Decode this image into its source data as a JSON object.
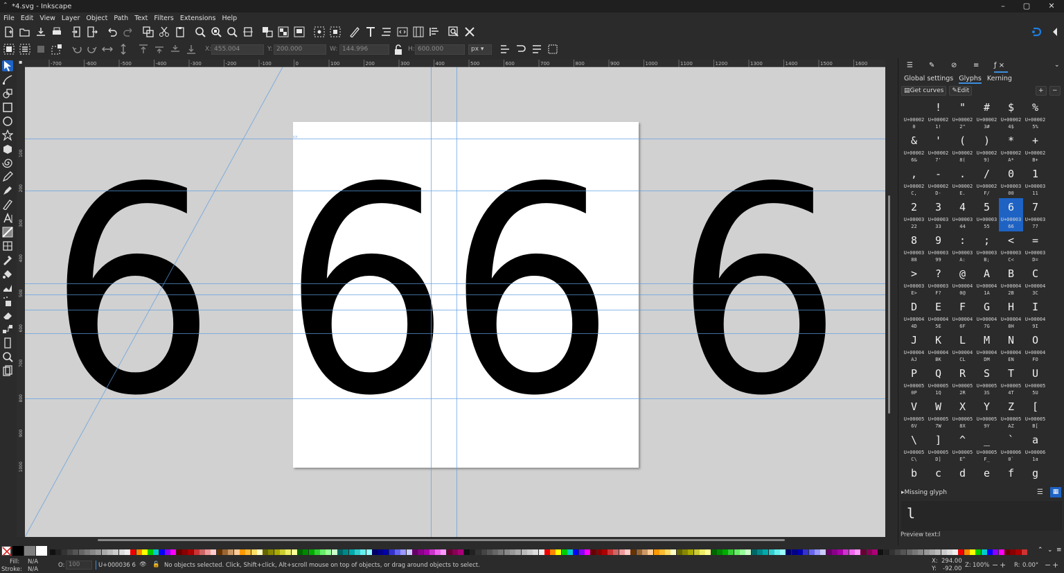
{
  "window": {
    "title": "*4.svg - Inkscape",
    "minimize": "–",
    "maximize": "▢",
    "close": "✕"
  },
  "menu": [
    "File",
    "Edit",
    "View",
    "Layer",
    "Object",
    "Path",
    "Text",
    "Filters",
    "Extensions",
    "Help"
  ],
  "controls": {
    "x_label": "X:",
    "x": "455.004",
    "y_label": "Y:",
    "y": "200.000",
    "w_label": "W:",
    "w": "144.996",
    "h_label": "H:",
    "h": "600.000",
    "unit": "px"
  },
  "ruler": {
    "h": [
      "-700",
      "-600",
      "-500",
      "-400",
      "-300",
      "-200",
      "-100",
      "0",
      "100",
      "200",
      "300",
      "400",
      "500",
      "600",
      "700",
      "800",
      "900",
      "1000",
      "1100",
      "1200",
      "1300",
      "1400",
      "1500",
      "1600"
    ],
    "v": [
      "100",
      "200",
      "300",
      "400",
      "500",
      "600",
      "700",
      "800",
      "900",
      "1000"
    ]
  },
  "canvas": {
    "glyph": "6"
  },
  "panel": {
    "subtabs": [
      "Global settings",
      "Glyphs",
      "Kerning"
    ],
    "get_curves": "Get curves",
    "edit": "Edit",
    "plus": "+",
    "minus": "−",
    "glyphs": [
      {
        "g": " ",
        "c": "U+00002\n0"
      },
      {
        "g": "!",
        "c": "U+00002\n1!"
      },
      {
        "g": "\"",
        "c": "U+00002\n2\""
      },
      {
        "g": "#",
        "c": "U+00002\n3#"
      },
      {
        "g": "$",
        "c": "U+00002\n4$"
      },
      {
        "g": "%",
        "c": "U+00002\n5%"
      },
      {
        "g": "&",
        "c": "U+00002\n6&"
      },
      {
        "g": "'",
        "c": "U+00002\n7'"
      },
      {
        "g": "(",
        "c": "U+00002\n8("
      },
      {
        "g": ")",
        "c": "U+00002\n9)"
      },
      {
        "g": "*",
        "c": "U+00002\nA*"
      },
      {
        "g": "+",
        "c": "U+00002\nB+"
      },
      {
        "g": ",",
        "c": "U+00002\nC,"
      },
      {
        "g": "-",
        "c": "U+00002\nD-"
      },
      {
        "g": ".",
        "c": "U+00002\nE."
      },
      {
        "g": "/",
        "c": "U+00002\nF/"
      },
      {
        "g": "0",
        "c": "U+00003\n00"
      },
      {
        "g": "1",
        "c": "U+00003\n11"
      },
      {
        "g": "2",
        "c": "U+00003\n22"
      },
      {
        "g": "3",
        "c": "U+00003\n33"
      },
      {
        "g": "4",
        "c": "U+00003\n44"
      },
      {
        "g": "5",
        "c": "U+00003\n55"
      },
      {
        "g": "6",
        "c": "U+00003\n66"
      },
      {
        "g": "7",
        "c": "U+00003\n77"
      },
      {
        "g": "8",
        "c": "U+00003\n88"
      },
      {
        "g": "9",
        "c": "U+00003\n99"
      },
      {
        "g": ":",
        "c": "U+00003\nA:"
      },
      {
        "g": ";",
        "c": "U+00003\nB;"
      },
      {
        "g": "<",
        "c": "U+00003\nC<"
      },
      {
        "g": "=",
        "c": "U+00003\nD="
      },
      {
        "g": ">",
        "c": "U+00003\nE>"
      },
      {
        "g": "?",
        "c": "U+00003\nF?"
      },
      {
        "g": "@",
        "c": "U+00004\n0@"
      },
      {
        "g": "A",
        "c": "U+00004\n1A"
      },
      {
        "g": "B",
        "c": "U+00004\n2B"
      },
      {
        "g": "C",
        "c": "U+00004\n3C"
      },
      {
        "g": "D",
        "c": "U+00004\n4D"
      },
      {
        "g": "E",
        "c": "U+00004\n5E"
      },
      {
        "g": "F",
        "c": "U+00004\n6F"
      },
      {
        "g": "G",
        "c": "U+00004\n7G"
      },
      {
        "g": "H",
        "c": "U+00004\n8H"
      },
      {
        "g": "I",
        "c": "U+00004\n9I"
      },
      {
        "g": "J",
        "c": "U+00004\nAJ"
      },
      {
        "g": "K",
        "c": "U+00004\nBK"
      },
      {
        "g": "L",
        "c": "U+00004\nCL"
      },
      {
        "g": "M",
        "c": "U+00004\nDM"
      },
      {
        "g": "N",
        "c": "U+00004\nEN"
      },
      {
        "g": "O",
        "c": "U+00004\nFO"
      },
      {
        "g": "P",
        "c": "U+00005\n0P"
      },
      {
        "g": "Q",
        "c": "U+00005\n1Q"
      },
      {
        "g": "R",
        "c": "U+00005\n2R"
      },
      {
        "g": "S",
        "c": "U+00005\n3S"
      },
      {
        "g": "T",
        "c": "U+00005\n4T"
      },
      {
        "g": "U",
        "c": "U+00005\n5U"
      },
      {
        "g": "V",
        "c": "U+00005\n6V"
      },
      {
        "g": "W",
        "c": "U+00005\n7W"
      },
      {
        "g": "X",
        "c": "U+00005\n8X"
      },
      {
        "g": "Y",
        "c": "U+00005\n9Y"
      },
      {
        "g": "Z",
        "c": "U+00005\nAZ"
      },
      {
        "g": "[",
        "c": "U+00005\nB["
      },
      {
        "g": "\\",
        "c": "U+00005\nC\\"
      },
      {
        "g": "]",
        "c": "U+00005\nD]"
      },
      {
        "g": "^",
        "c": "U+00005\nE^"
      },
      {
        "g": "_",
        "c": "U+00005\nF_"
      },
      {
        "g": "`",
        "c": "U+00006\n0`"
      },
      {
        "g": "a",
        "c": "U+00006\n1a"
      },
      {
        "g": "b",
        "c": ""
      },
      {
        "g": "c",
        "c": ""
      },
      {
        "g": "d",
        "c": ""
      },
      {
        "g": "e",
        "c": ""
      },
      {
        "g": "f",
        "c": ""
      },
      {
        "g": "g",
        "c": ""
      }
    ],
    "selected_index": 22,
    "missing_glyph": "Missing glyph",
    "preview_char": "l",
    "preview_label": "Preview text:",
    "preview_value": "l"
  },
  "status": {
    "fill_label": "Fill:",
    "fill": "N/A",
    "stroke_label": "Stroke:",
    "stroke": "N/A",
    "opacity_label": "O:",
    "opacity": "100",
    "layer": "U+000036 6",
    "message": "No objects selected. Click, Shift+click, Alt+scroll mouse on top of objects, or drag around objects to select.",
    "x_label": "X:",
    "x": "294.00",
    "y_label": "Y:",
    "y": "-92.00",
    "zoom_label": "Z:",
    "zoom": "100%",
    "rot_label": "R:",
    "rotation": "0.00°"
  },
  "colors": {
    "accent": "#1e63c4",
    "guide": "#5c9de0"
  }
}
